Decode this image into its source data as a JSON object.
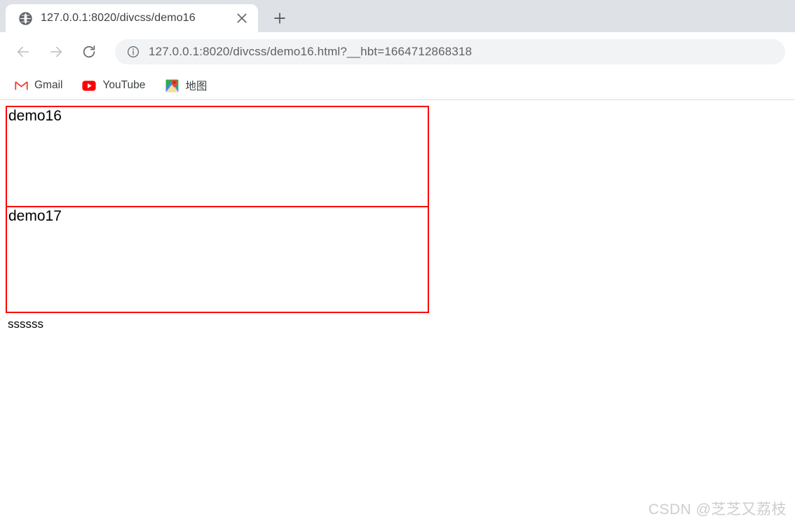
{
  "browser": {
    "tab": {
      "favicon": "globe-icon",
      "title": "127.0.0.1:8020/divcss/demo16",
      "close_label": "✕"
    },
    "newtab_label": "+",
    "toolbar": {
      "back_label": "←",
      "forward_label": "→",
      "reload_label": "⟳",
      "security_icon": "info-circle-icon",
      "url": "127.0.0.1:8020/divcss/demo16.html?__hbt=1664712868318"
    },
    "bookmarks": [
      {
        "icon": "gmail-icon",
        "label": "Gmail"
      },
      {
        "icon": "youtube-icon",
        "label": "YouTube"
      },
      {
        "icon": "google-maps-icon",
        "label": "地图"
      }
    ]
  },
  "page": {
    "box1_text": "demo16",
    "box2_text": "demo17",
    "trailing_text": "ssssss",
    "box_border_color": "#ff0000"
  },
  "watermark": "CSDN @芝芝又荔枝"
}
